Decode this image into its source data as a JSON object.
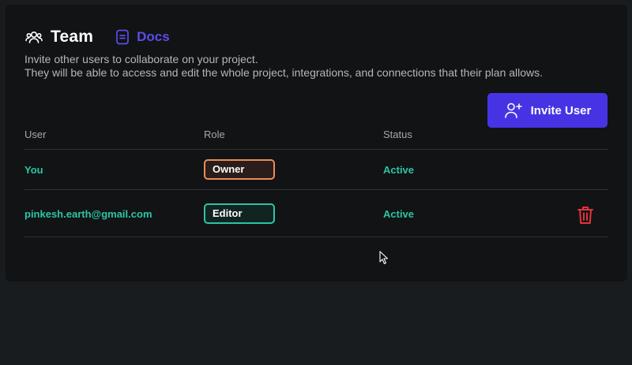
{
  "header": {
    "title": "Team",
    "docs_label": "Docs",
    "team_icon": "users-icon",
    "docs_icon": "document-icon"
  },
  "description": {
    "line1": "Invite other users to collaborate on your project.",
    "line2": "They will be able to access and edit the whole project, integrations, and connections that their plan allows."
  },
  "invite_button": {
    "label": "Invite User",
    "icon": "user-plus-icon"
  },
  "table": {
    "columns": [
      "User",
      "Role",
      "Status"
    ],
    "rows": [
      {
        "user": "You",
        "role": "Owner",
        "status": "Active",
        "deletable": false
      },
      {
        "user": "pinkesh.earth@gmail.com",
        "role": "Editor",
        "status": "Active",
        "deletable": true
      }
    ]
  },
  "colors": {
    "accent": "#4634e4",
    "docs": "#5b4dea",
    "active": "#2ec4a4",
    "owner_border": "#f08a5d",
    "editor_border": "#2ec4a4",
    "danger": "#e5323b"
  }
}
